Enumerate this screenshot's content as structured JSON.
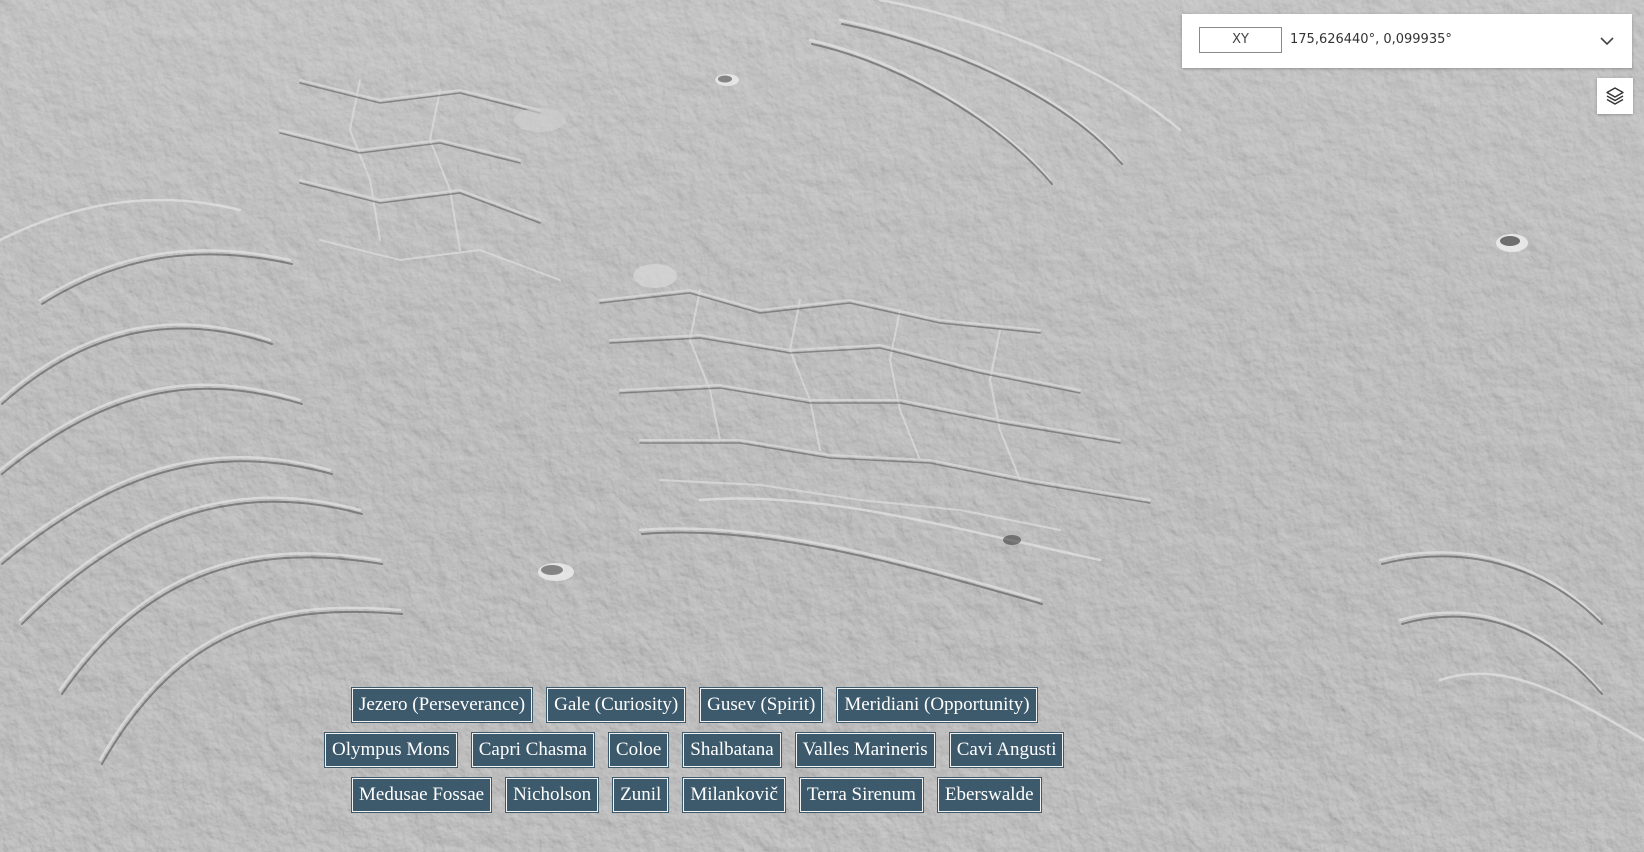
{
  "coordinates": {
    "projection_label": "XY",
    "value": "175,626440°, 0,099935°"
  },
  "icons": {
    "expand": "chevron-down-icon",
    "layers": "layers-icon"
  },
  "locations": {
    "row1": [
      {
        "label": "Jezero (Perseverance)"
      },
      {
        "label": "Gale (Curiosity)"
      },
      {
        "label": "Gusev (Spirit)"
      },
      {
        "label": "Meridiani (Opportunity)"
      }
    ],
    "row2": [
      {
        "label": "Olympus Mons"
      },
      {
        "label": "Capri Chasma"
      },
      {
        "label": "Coloe"
      },
      {
        "label": "Shalbatana"
      },
      {
        "label": "Valles Marineris"
      },
      {
        "label": "Cavi Angusti"
      }
    ],
    "row3": [
      {
        "label": "Medusae Fossae"
      },
      {
        "label": "Nicholson"
      },
      {
        "label": "Zunil"
      },
      {
        "label": "Milankovič"
      },
      {
        "label": "Terra Sirenum"
      },
      {
        "label": "Eberswalde"
      }
    ]
  },
  "colors": {
    "button_background": "#3d5a6c",
    "button_border": "#f2f2f2",
    "panel_background": "#ffffff"
  }
}
